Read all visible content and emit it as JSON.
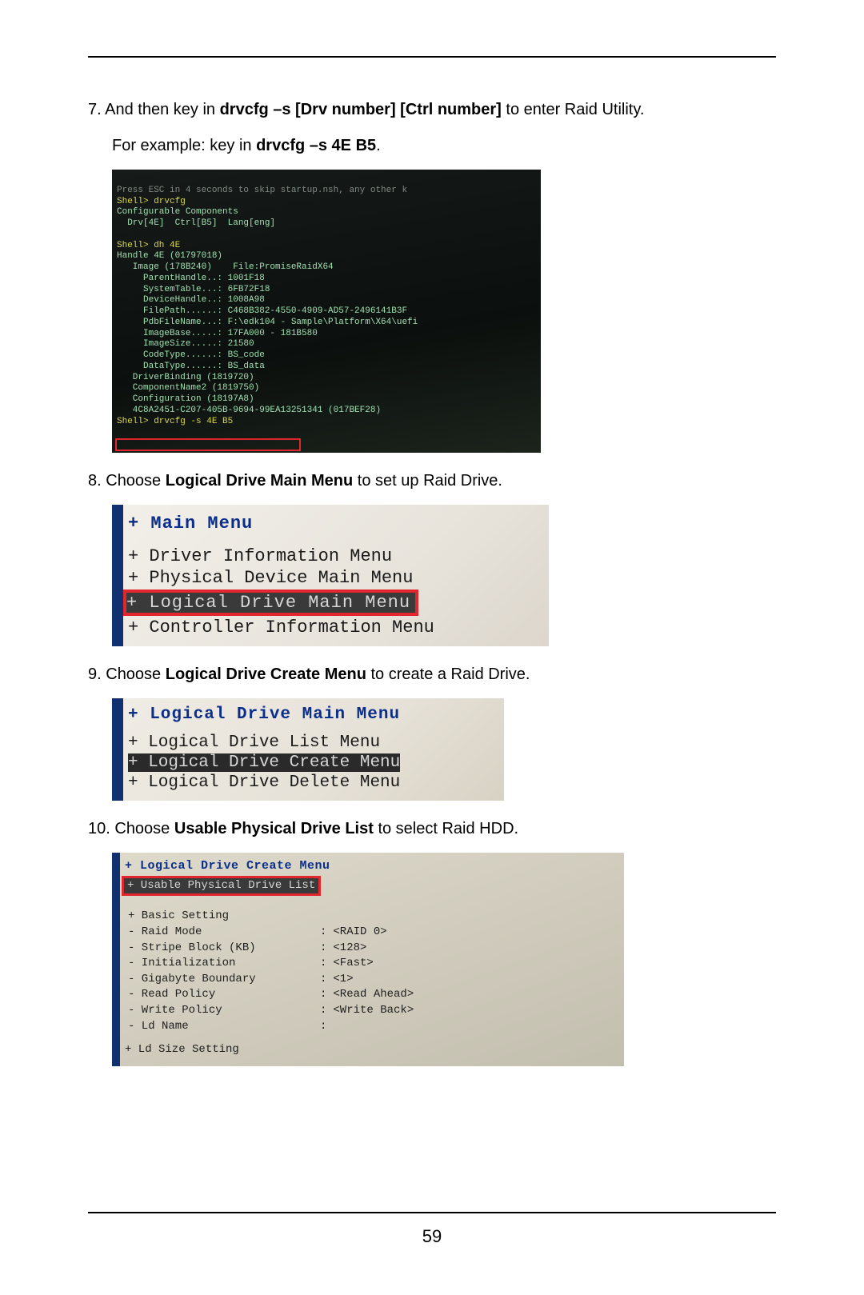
{
  "page_number": "59",
  "steps": {
    "s7": {
      "num": "7.",
      "pre": " And then key in ",
      "bold1": "drvcfg –s [Drv number] [Ctrl number]",
      "post1": " to enter Raid Utility.",
      "line2_pre": "For example: key in ",
      "line2_bold": "drvcfg –s 4E B5",
      "line2_post": "."
    },
    "s8": {
      "num": "8.",
      "pre": " Choose ",
      "bold": "Logical Drive Main Menu",
      "post": " to set up Raid Drive."
    },
    "s9": {
      "num": "9.",
      "pre": " Choose ",
      "bold": "Logical Drive Create Menu",
      "post": " to create a Raid Drive."
    },
    "s10": {
      "num": "10.",
      "pre": " Choose ",
      "bold": "Usable Physical Drive List",
      "post": " to select Raid HDD."
    }
  },
  "shot1": {
    "l0": "Press ESC in 4 seconds to skip startup.nsh, any other k",
    "l1": "Shell> drvcfg",
    "l2": "Configurable Components",
    "l3": "  Drv[4E]  Ctrl[B5]  Lang[eng]",
    "l4": "",
    "l5": "Shell> dh 4E",
    "l6": "Handle 4E (01797018)",
    "l7": "   Image (178B240)    File:PromiseRaidX64",
    "l8": "     ParentHandle..: 1001F18",
    "l9": "     SystemTable...: 6FB72F18",
    "l10": "     DeviceHandle..: 1008A98",
    "l11": "     FilePath......: C468B382-4550-4909-AD57-2496141B3F",
    "l12": "     PdbFileName...: F:\\edk104 - Sample\\Platform\\X64\\uefi",
    "l13": "     ImageBase.....: 17FA000 - 181B580",
    "l14": "     ImageSize.....: 21580",
    "l15": "     CodeType......: BS_code",
    "l16": "     DataType......: BS_data",
    "l17": "   DriverBinding (1819720)",
    "l18": "   ComponentName2 (1819750)",
    "l19": "   Configuration (18197A8)",
    "l20": "   4C8A2451-C207-405B-9694-99EA13251341 (017BEF28)",
    "l21": "Shell> drvcfg -s 4E B5"
  },
  "shot2": {
    "title": "+ Main Menu",
    "r1": "+ Driver Information Menu",
    "r2": "+ Physical Device Main Menu",
    "r3": "+ Logical Drive Main Menu",
    "r4": "+ Controller Information Menu"
  },
  "shot3": {
    "title": "+ Logical Drive Main Menu",
    "r1": "+ Logical Drive List Menu",
    "r2": "+ Logical Drive Create Menu",
    "r3": "+ Logical Drive Delete Menu"
  },
  "shot4": {
    "title": "+ Logical Drive Create Menu",
    "hl": "+ Usable Physical Drive List",
    "rows": [
      {
        "label": "+ Basic Setting",
        "colon": "",
        "val": ""
      },
      {
        "label": "- Raid Mode",
        "colon": ":",
        "val": "<RAID 0>"
      },
      {
        "label": "- Stripe Block (KB)",
        "colon": ":",
        "val": "<128>"
      },
      {
        "label": "- Initialization",
        "colon": ":",
        "val": "<Fast>"
      },
      {
        "label": "- Gigabyte Boundary",
        "colon": ":",
        "val": "<1>"
      },
      {
        "label": "- Read Policy",
        "colon": ":",
        "val": "<Read Ahead>"
      },
      {
        "label": "- Write Policy",
        "colon": ":",
        "val": "<Write Back>"
      },
      {
        "label": "- Ld Name",
        "colon": ":",
        "val": ""
      }
    ],
    "last": "+ Ld Size Setting"
  }
}
